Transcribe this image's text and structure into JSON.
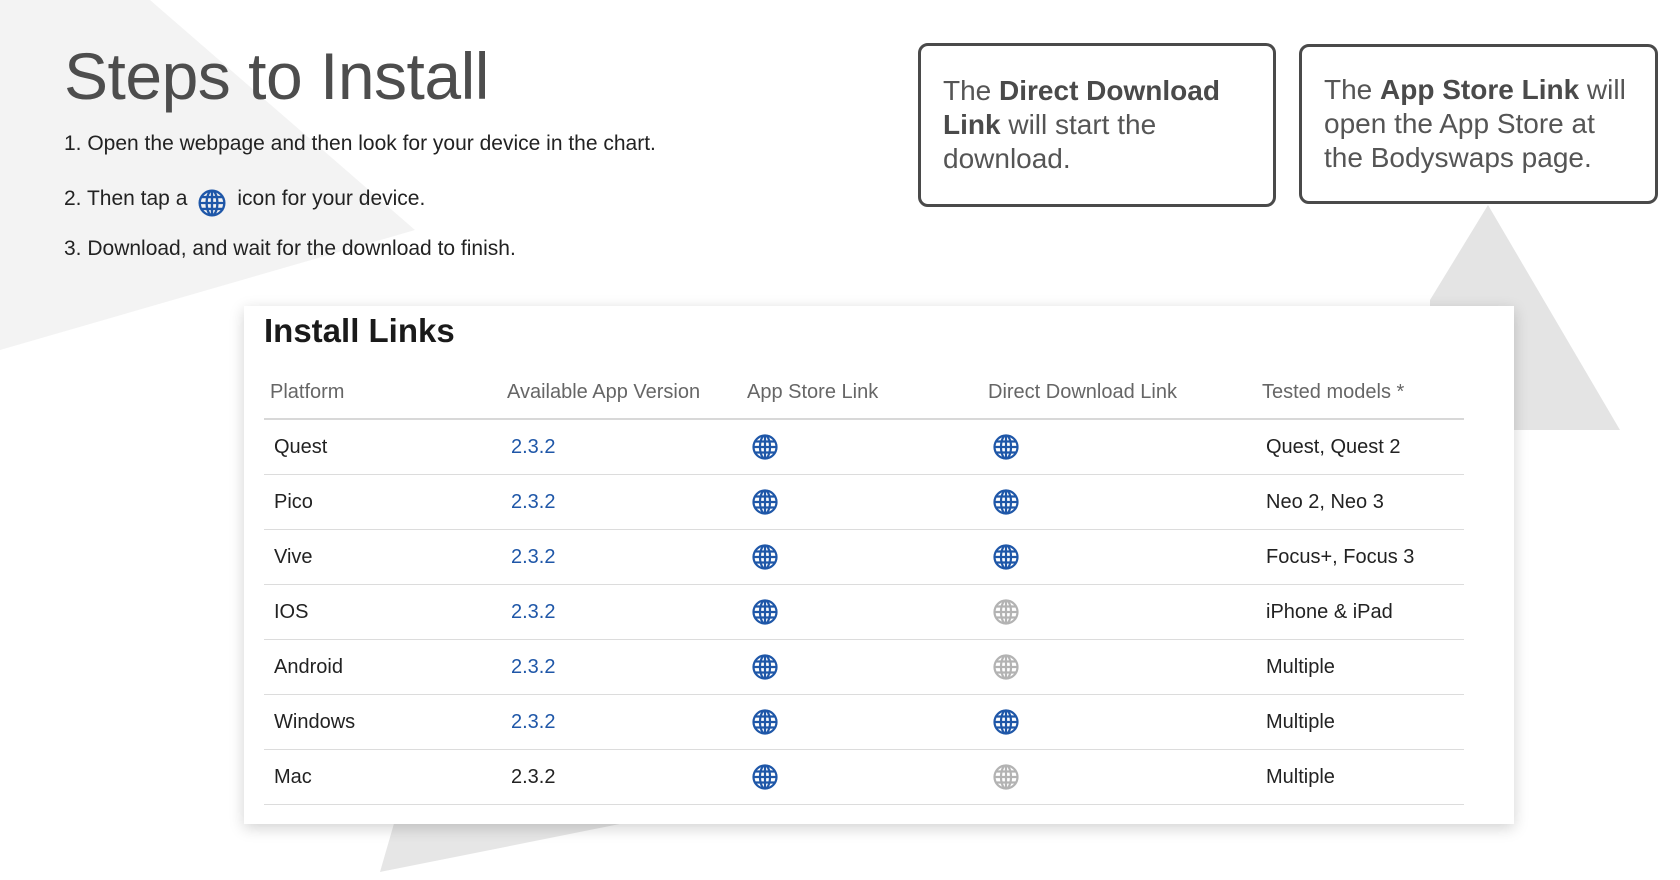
{
  "heading": "Steps to Install",
  "steps": [
    {
      "text": "1. Open the webpage and then look for your device in the chart."
    },
    {
      "before": "2. Then tap a",
      "icon": "globe-icon",
      "after": "icon for your device."
    },
    {
      "text": "3. Download, and wait for the download to finish."
    }
  ],
  "callouts": {
    "direct": {
      "pre": "The ",
      "bold": "Direct Download Link",
      "post": " will start the download."
    },
    "store": {
      "pre": "The ",
      "bold": "App Store Link",
      "post": " will open the App Store at the Bodyswaps page."
    }
  },
  "install_links": {
    "title": "Install Links",
    "headers": [
      "Platform",
      "Available App Version",
      "App Store Link",
      "Direct Download Link",
      "Tested models *"
    ],
    "rows": [
      {
        "platform": "Quest",
        "version": "2.3.2",
        "version_link": true,
        "store": "active",
        "direct": "active",
        "models": "Quest, Quest 2"
      },
      {
        "platform": "Pico",
        "version": "2.3.2",
        "version_link": true,
        "store": "active",
        "direct": "active",
        "models": "Neo 2, Neo 3"
      },
      {
        "platform": "Vive",
        "version": "2.3.2",
        "version_link": true,
        "store": "active",
        "direct": "active",
        "models": "Focus+, Focus 3"
      },
      {
        "platform": "IOS",
        "version": "2.3.2",
        "version_link": true,
        "store": "active",
        "direct": "disabled",
        "models": "iPhone & iPad"
      },
      {
        "platform": "Android",
        "version": "2.3.2",
        "version_link": true,
        "store": "active",
        "direct": "disabled",
        "models": "Multiple"
      },
      {
        "platform": "Windows",
        "version": "2.3.2",
        "version_link": true,
        "store": "active",
        "direct": "active",
        "models": "Multiple"
      },
      {
        "platform": "Mac",
        "version": "2.3.2",
        "version_link": false,
        "store": "active",
        "direct": "disabled",
        "models": "Multiple"
      }
    ]
  },
  "colors": {
    "link": "#1f57a8",
    "icon_active": "#1f57a8",
    "icon_disabled": "#b3b3b3",
    "border": "#4a4a4a"
  }
}
